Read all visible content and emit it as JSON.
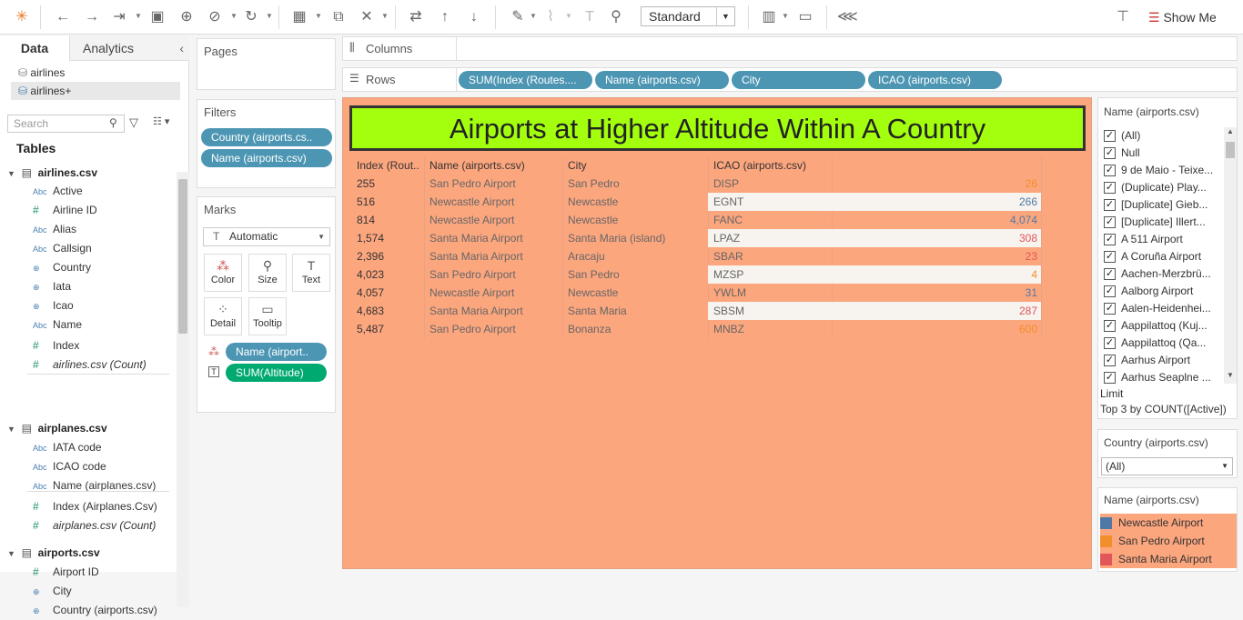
{
  "toolbar": {
    "view_size": "Standard",
    "show_me": "Show Me"
  },
  "datapane": {
    "tab_data": "Data",
    "tab_analytics": "Analytics",
    "sources": [
      "airlines",
      "airlines+"
    ],
    "search_placeholder": "Search",
    "tables_label": "Tables",
    "tables": [
      {
        "name": "airlines.csv",
        "fields": [
          {
            "icon": "Abc",
            "name": "Active"
          },
          {
            "icon": "#",
            "name": "Airline ID"
          },
          {
            "icon": "Abc",
            "name": "Alias"
          },
          {
            "icon": "Abc",
            "name": "Callsign"
          },
          {
            "icon": "globe",
            "name": "Country"
          },
          {
            "icon": "globe",
            "name": "Iata"
          },
          {
            "icon": "globe",
            "name": "Icao"
          },
          {
            "icon": "Abc",
            "name": "Name"
          },
          {
            "icon": "#",
            "name": "Index"
          },
          {
            "icon": "#",
            "name": "airlines.csv (Count)"
          }
        ]
      },
      {
        "name": "airplanes.csv",
        "fields": [
          {
            "icon": "Abc",
            "name": "IATA code"
          },
          {
            "icon": "Abc",
            "name": "ICAO code"
          },
          {
            "icon": "Abc",
            "name": "Name (airplanes.csv)"
          },
          {
            "icon": "#",
            "name": "Index (Airplanes.Csv)"
          },
          {
            "icon": "#",
            "name": "airplanes.csv (Count)"
          }
        ]
      },
      {
        "name": "airports.csv",
        "fields": [
          {
            "icon": "#",
            "name": "Airport ID"
          },
          {
            "icon": "globe",
            "name": "City"
          },
          {
            "icon": "globe",
            "name": "Country (airports.csv)"
          }
        ]
      }
    ]
  },
  "pages": {
    "label": "Pages"
  },
  "filters": {
    "label": "Filters",
    "items": [
      "Country (airports.cs..",
      "Name (airports.csv)"
    ]
  },
  "marks": {
    "label": "Marks",
    "type": "Automatic",
    "buttons": [
      "Color",
      "Size",
      "Text",
      "Detail",
      "Tooltip"
    ],
    "pills": [
      "Name (airport..",
      "SUM(Altitude)"
    ]
  },
  "columns": {
    "label": "Columns"
  },
  "rows": {
    "label": "Rows",
    "pills": [
      "SUM(Index (Routes....",
      "Name (airports.csv)",
      "City",
      "ICAO (airports.csv)"
    ]
  },
  "viz": {
    "title": "Airports at Higher Altitude Within A Country",
    "headers": [
      "Index (Rout..",
      "Name (airports.csv)",
      "City",
      "ICAO (airports.csv)"
    ],
    "rows": [
      {
        "index": "255",
        "name": "San Pedro Airport",
        "city": "San Pedro",
        "icao": "DISP",
        "alt": "26",
        "c": "#f28e2b"
      },
      {
        "index": "516",
        "name": "Newcastle Airport",
        "city": "Newcastle",
        "icao": "EGNT",
        "alt": "266",
        "c": "#4e79a7"
      },
      {
        "index": "814",
        "name": "Newcastle Airport",
        "city": "Newcastle",
        "icao": "FANC",
        "alt": "4,074",
        "c": "#4e79a7"
      },
      {
        "index": "1,574",
        "name": "Santa Maria Airport",
        "city": "Santa Maria (island)",
        "icao": "LPAZ",
        "alt": "308",
        "c": "#e15759"
      },
      {
        "index": "2,396",
        "name": "Santa Maria Airport",
        "city": "Aracaju",
        "icao": "SBAR",
        "alt": "23",
        "c": "#e15759"
      },
      {
        "index": "4,023",
        "name": "San Pedro Airport",
        "city": "San Pedro",
        "icao": "MZSP",
        "alt": "4",
        "c": "#f28e2b"
      },
      {
        "index": "4,057",
        "name": "Newcastle Airport",
        "city": "Newcastle",
        "icao": "YWLM",
        "alt": "31",
        "c": "#4e79a7"
      },
      {
        "index": "4,683",
        "name": "Santa Maria Airport",
        "city": "Santa Maria",
        "icao": "SBSM",
        "alt": "287",
        "c": "#e15759"
      },
      {
        "index": "5,487",
        "name": "San Pedro Airport",
        "city": "Bonanza",
        "icao": "MNBZ",
        "alt": "600",
        "c": "#f28e2b"
      }
    ]
  },
  "name_filter": {
    "title": "Name (airports.csv)",
    "items": [
      "(All)",
      "Null",
      "9 de Maio - Teixe...",
      "(Duplicate) Play...",
      "[Duplicate] Gieb...",
      "[Duplicate] Illert...",
      "A 511 Airport",
      "A Coruña Airport",
      "Aachen-Merzbrü...",
      "Aalborg Airport",
      "Aalen-Heidenhei...",
      "Aappilattoq (Kuj...",
      "Aappilattoq (Qa...",
      "Aarhus Airport",
      "Aarhus Seaplne ..."
    ],
    "limit_label": "Limit",
    "limit_value": "Top 3 by COUNT([Active])"
  },
  "country_filter": {
    "title": "Country (airports.csv)",
    "value": "(All)"
  },
  "legend": {
    "title": "Name (airports.csv)",
    "items": [
      {
        "name": "Newcastle Airport",
        "color": "#4e79a7"
      },
      {
        "name": "San Pedro Airport",
        "color": "#f28e2b"
      },
      {
        "name": "Santa Maria Airport",
        "color": "#e15759"
      }
    ]
  }
}
